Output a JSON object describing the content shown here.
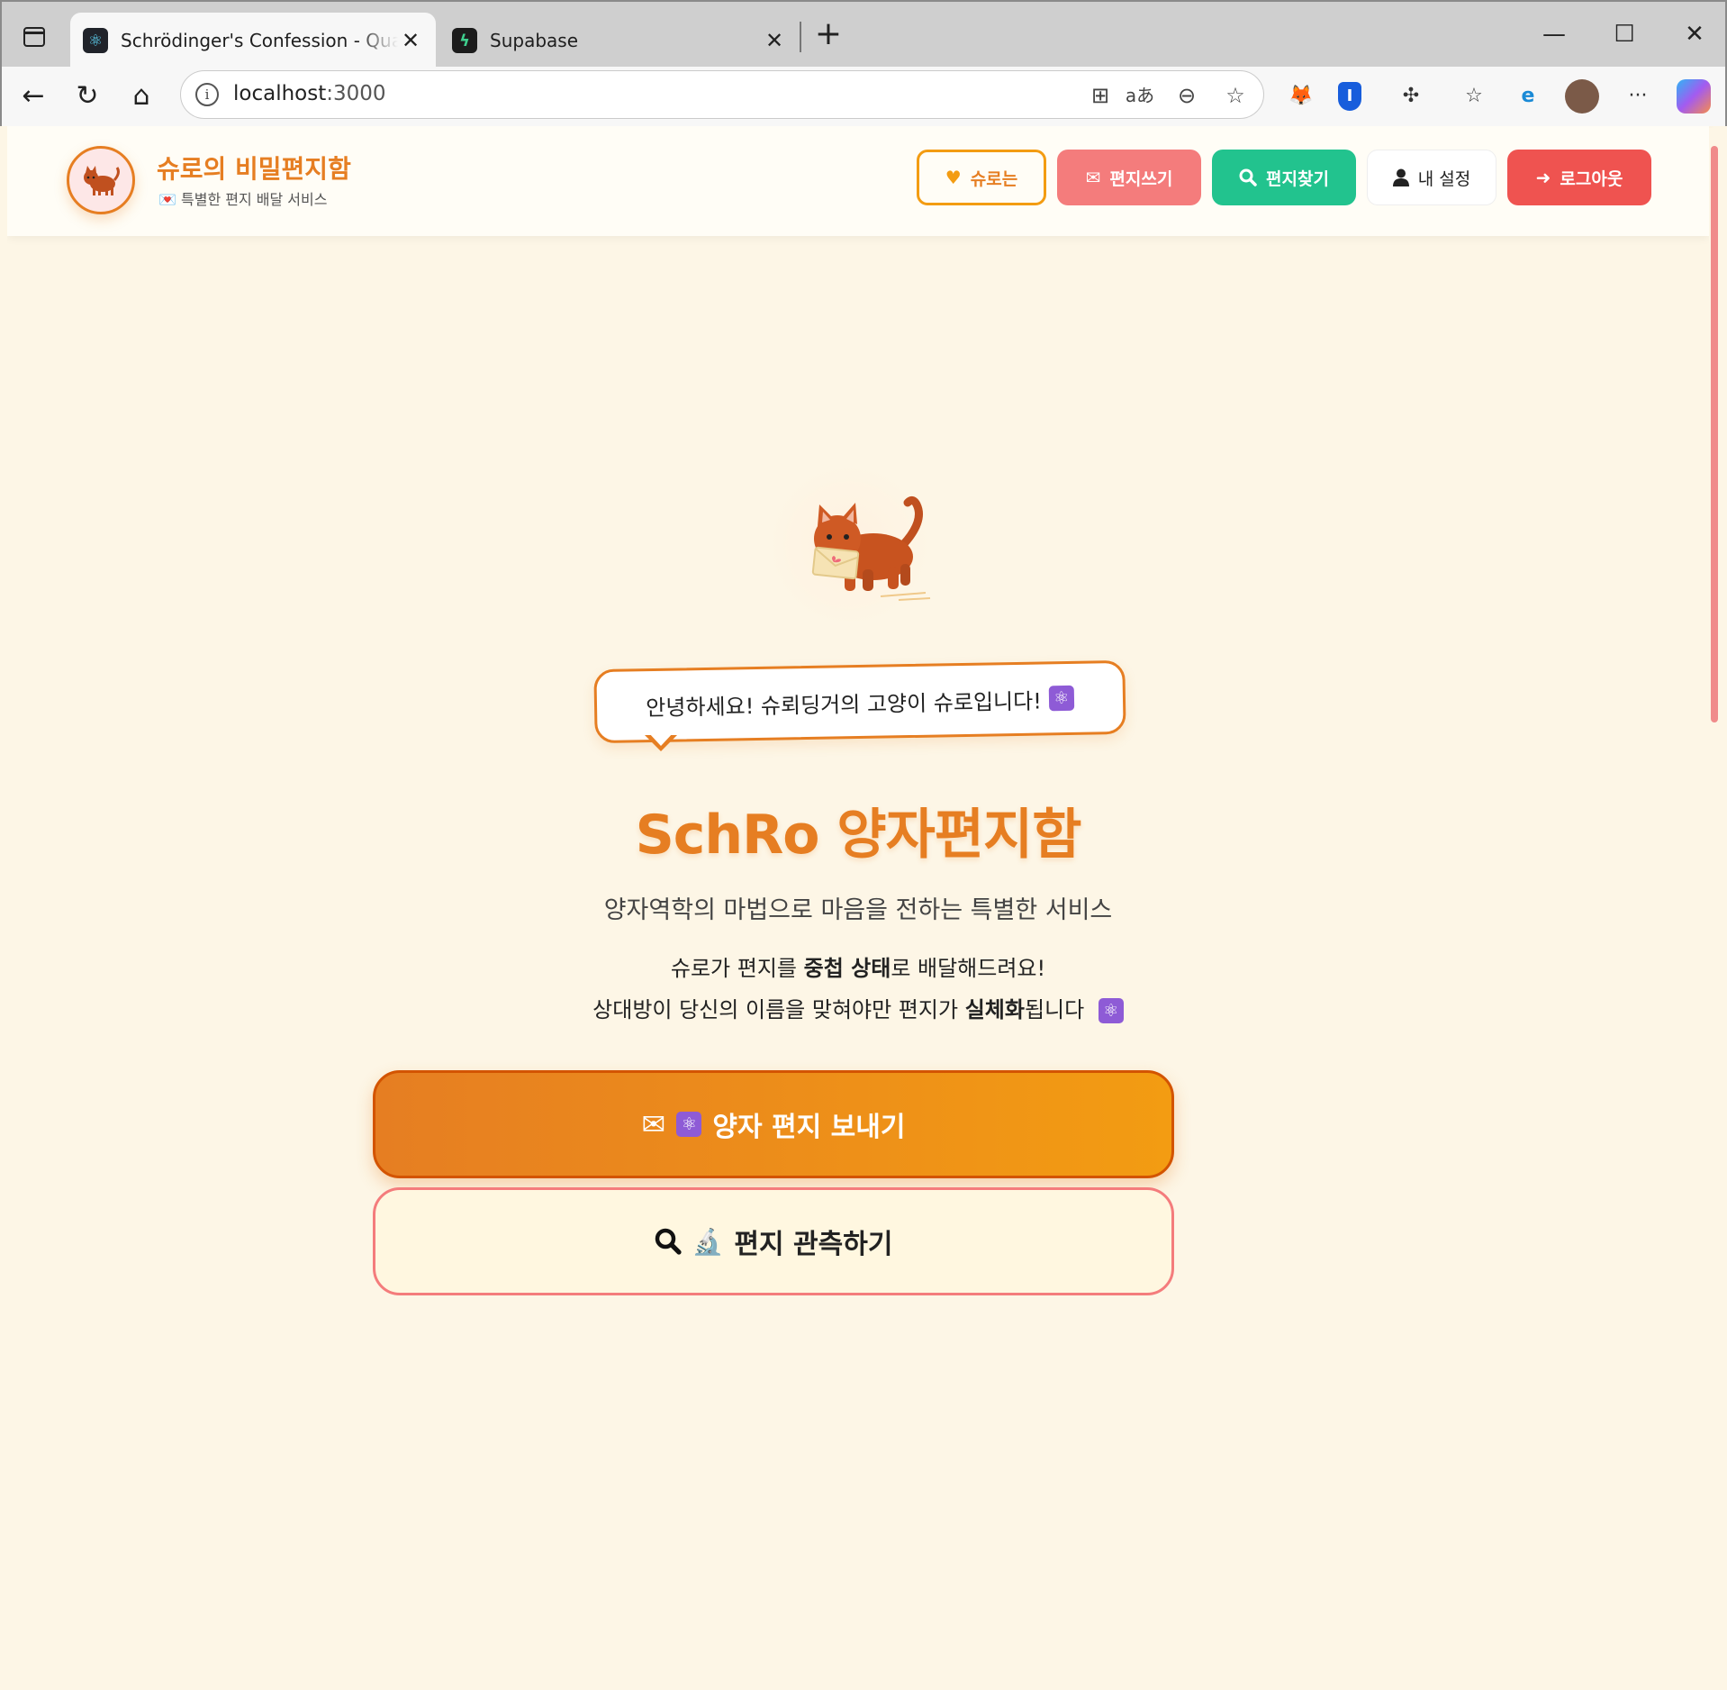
{
  "browser": {
    "tabs": [
      {
        "title": "Schrödinger's Confession - Quantum",
        "icon": "react-icon",
        "active": true
      },
      {
        "title": "Supabase",
        "icon": "supabase-icon",
        "active": false
      }
    ],
    "url_host": "localhost",
    "url_port": ":3000"
  },
  "header": {
    "brand_title": "슈로의 비밀편지함",
    "brand_subtitle": "💌 특별한 편지 배달 서비스",
    "nav": {
      "about": "슈로는",
      "write": "편지쓰기",
      "find": "편지찾기",
      "settings": "내 설정",
      "logout": "로그아웃"
    }
  },
  "hero": {
    "speech": "안녕하세요! 슈뢰딩거의 고양이 슈로입니다!",
    "title": "SchRo 양자편지함",
    "subtitle": "양자역학의 마법으로 마음을 전하는 특별한 서비스",
    "desc_line1_a": "슈로가 편지를 ",
    "desc_line1_b": "중첩 상태",
    "desc_line1_c": "로 배달해드려요!",
    "desc_line2_a": "상대방이 당신의 이름을 맞혀야만 편지가 ",
    "desc_line2_b": "실체화",
    "desc_line2_c": "됩니다"
  },
  "cta": {
    "send": "양자 편지 보내기",
    "observe": "편지 관측하기"
  },
  "colors": {
    "accent": "#e67e22",
    "accent_light": "#f39c12",
    "coral": "#f47c7c",
    "green": "#22c38e",
    "red": "#ef5350",
    "page_bg": "#fdf6e6"
  }
}
